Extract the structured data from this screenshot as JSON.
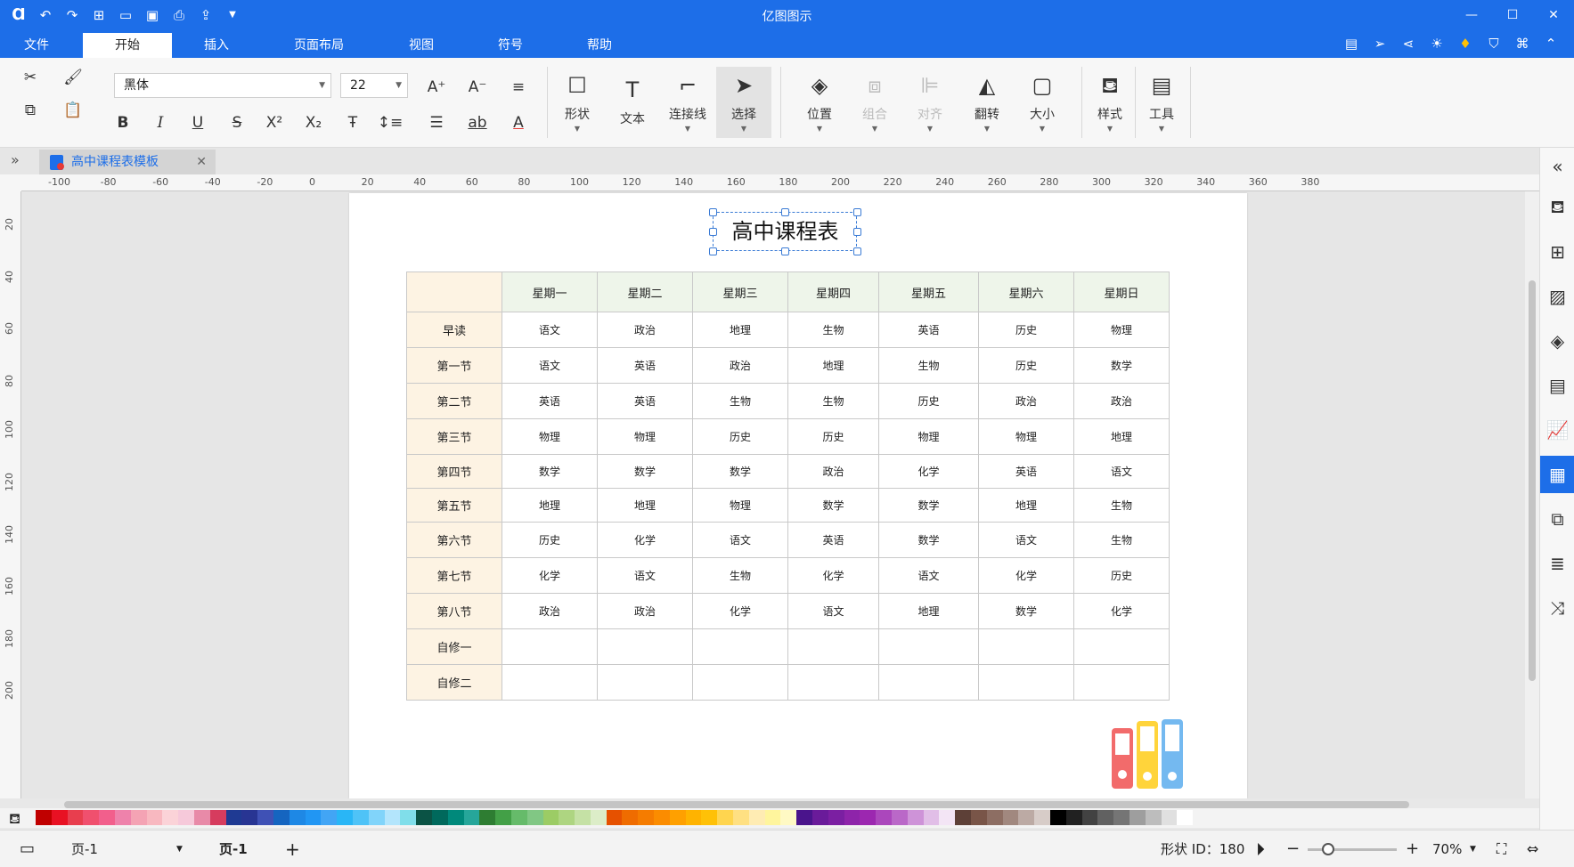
{
  "app": {
    "title": "亿图图示"
  },
  "menu": {
    "tabs": [
      {
        "label": "文件"
      },
      {
        "label": "开始"
      },
      {
        "label": "插入"
      },
      {
        "label": "页面布局"
      },
      {
        "label": "视图"
      },
      {
        "label": "符号"
      },
      {
        "label": "帮助"
      }
    ],
    "active": "开始"
  },
  "ribbon": {
    "font_family": "黑体",
    "font_size": "22",
    "tools": {
      "shape": "形状",
      "text": "文本",
      "connector": "连接线",
      "select": "选择",
      "position": "位置",
      "group": "组合",
      "align": "对齐",
      "flip": "翻转",
      "size": "大小",
      "style": "样式",
      "tools": "工具"
    }
  },
  "document": {
    "tab_title": "高中课程表模板"
  },
  "rulers": {
    "horizontal": [
      "-100",
      "-80",
      "-60",
      "-40",
      "-20",
      "0",
      "20",
      "40",
      "60",
      "80",
      "100",
      "120",
      "140",
      "160",
      "180",
      "200",
      "220",
      "240",
      "260",
      "280",
      "300",
      "320",
      "340",
      "360",
      "380"
    ],
    "vertical": [
      "20",
      "40",
      "60",
      "80",
      "100",
      "120",
      "140",
      "160",
      "180",
      "200"
    ]
  },
  "schedule": {
    "title": "高中课程表",
    "days": [
      "星期一",
      "星期二",
      "星期三",
      "星期四",
      "星期五",
      "星期六",
      "星期日"
    ],
    "rows": [
      {
        "period": "早读",
        "cells": [
          "语文",
          "政治",
          "地理",
          "生物",
          "英语",
          "历史",
          "物理"
        ]
      },
      {
        "period": "第一节",
        "cells": [
          "语文",
          "英语",
          "政治",
          "地理",
          "生物",
          "历史",
          "数学"
        ]
      },
      {
        "period": "第二节",
        "cells": [
          "英语",
          "英语",
          "生物",
          "生物",
          "历史",
          "政治",
          "政治"
        ]
      },
      {
        "period": "第三节",
        "cells": [
          "物理",
          "物理",
          "历史",
          "历史",
          "物理",
          "物理",
          "地理"
        ]
      },
      {
        "period": "第四节",
        "cells": [
          "数学",
          "数学",
          "数学",
          "政治",
          "化学",
          "英语",
          "语文"
        ]
      },
      {
        "period": "第五节",
        "cells": [
          "地理",
          "地理",
          "物理",
          "数学",
          "数学",
          "地理",
          "生物"
        ]
      },
      {
        "period": "第六节",
        "cells": [
          "历史",
          "化学",
          "语文",
          "英语",
          "数学",
          "语文",
          "生物"
        ]
      },
      {
        "period": "第七节",
        "cells": [
          "化学",
          "语文",
          "生物",
          "化学",
          "语文",
          "化学",
          "历史"
        ]
      },
      {
        "period": "第八节",
        "cells": [
          "政治",
          "政治",
          "化学",
          "语文",
          "地理",
          "数学",
          "化学"
        ]
      },
      {
        "period": "自修一",
        "cells": [
          "",
          "",
          "",
          "",
          "",
          "",
          ""
        ]
      },
      {
        "period": "自修二",
        "cells": [
          "",
          "",
          "",
          "",
          "",
          "",
          ""
        ]
      }
    ]
  },
  "palette": {
    "colors": [
      "#c00000",
      "#e81123",
      "#e83e4e",
      "#f0506e",
      "#f25f8c",
      "#ee82ab",
      "#f4a3b4",
      "#f8b8c0",
      "#fbd3d8",
      "#f6c9da",
      "#e88aa8",
      "#d63c5e",
      "#1f3a93",
      "#283593",
      "#3f51b5",
      "#1565c0",
      "#1e88e5",
      "#2196f3",
      "#42a5f5",
      "#29b6f6",
      "#4fc3f7",
      "#81d4fa",
      "#b3e5fc",
      "#80deea",
      "#0b5345",
      "#00695c",
      "#00897b",
      "#26a69a",
      "#2e7d32",
      "#43a047",
      "#66bb6a",
      "#81c784",
      "#9ccc65",
      "#aed581",
      "#c5e1a5",
      "#dcedc8",
      "#e65100",
      "#ef6c00",
      "#f57c00",
      "#fb8c00",
      "#ffa000",
      "#ffb300",
      "#ffc107",
      "#ffd54f",
      "#ffe082",
      "#ffecb3",
      "#fff59d",
      "#fff9c4",
      "#4a148c",
      "#6a1b9a",
      "#7b1fa2",
      "#8e24aa",
      "#9c27b0",
      "#ab47bc",
      "#ba68c8",
      "#ce93d8",
      "#e1bee7",
      "#f3e5f5",
      "#5d4037",
      "#795548",
      "#8d6e63",
      "#a1887f",
      "#bcaaa4",
      "#d7ccc8",
      "#000000",
      "#212121",
      "#424242",
      "#616161",
      "#757575",
      "#9e9e9e",
      "#bdbdbd",
      "#e0e0e0",
      "#ffffff"
    ]
  },
  "status": {
    "page_selector": "页-1",
    "page_tab": "页-1",
    "shape_id": "形状 ID：180",
    "zoom": "70%"
  }
}
